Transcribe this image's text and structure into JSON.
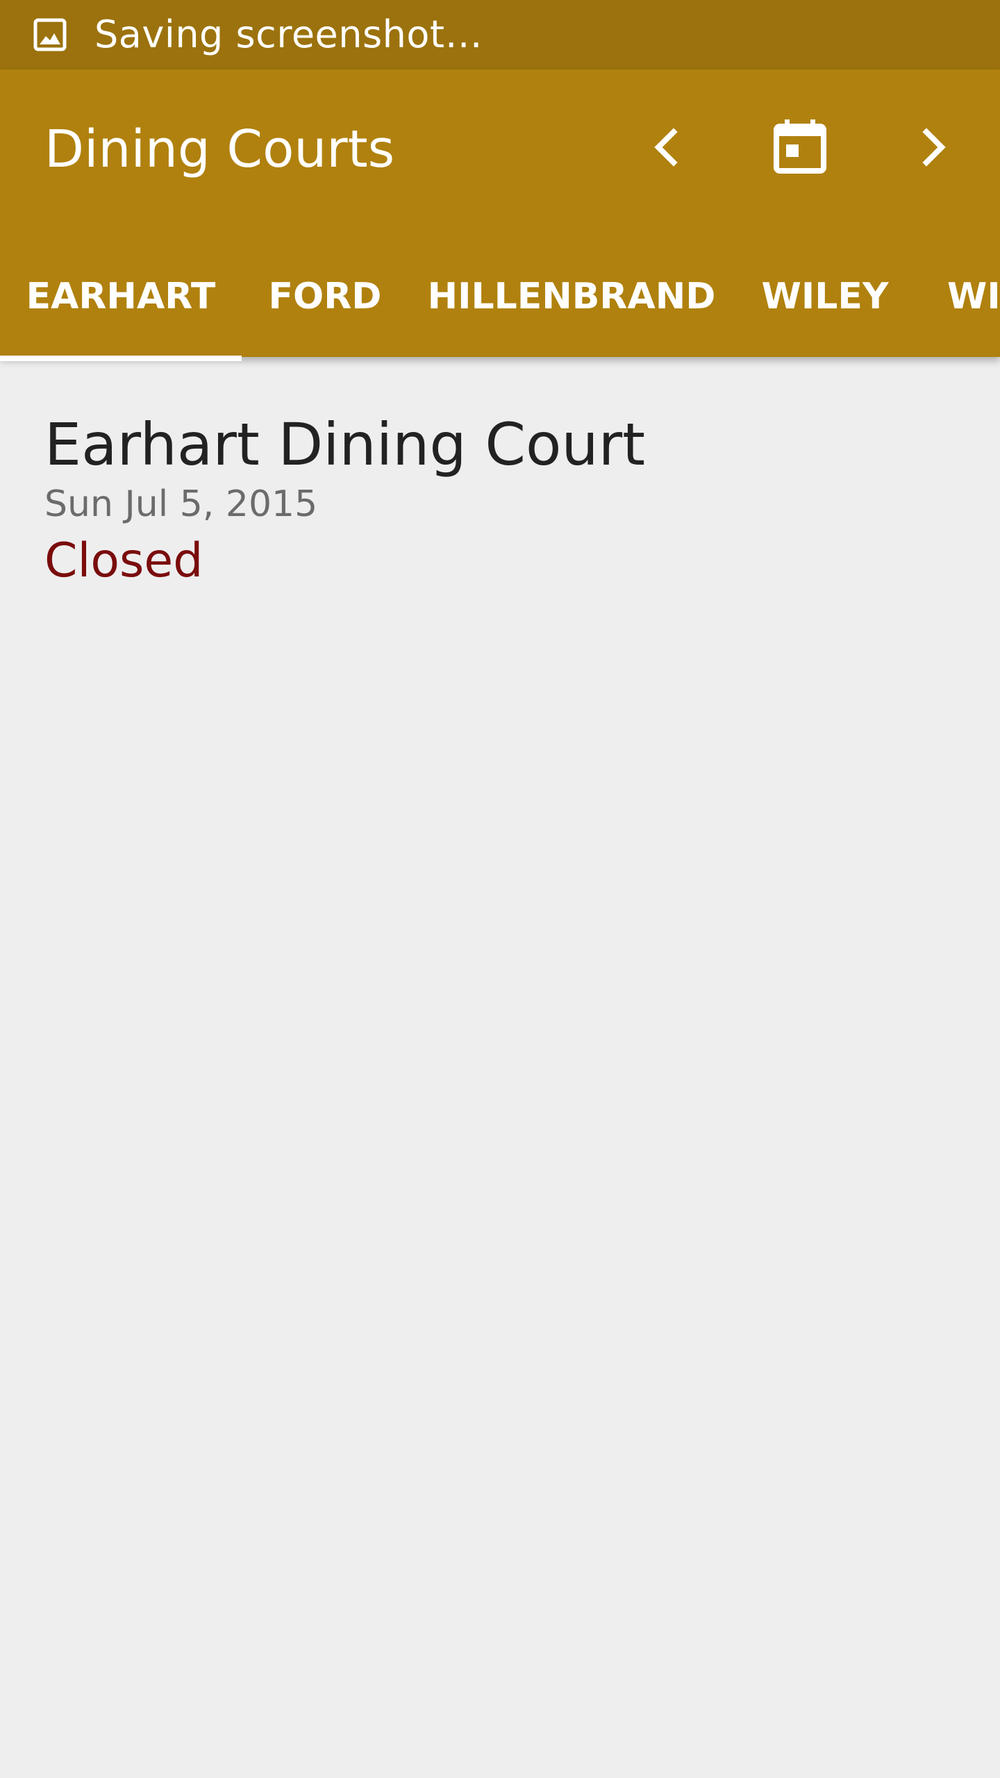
{
  "status_bar": {
    "notification_icon": "image-icon",
    "text": "Saving screenshot…"
  },
  "app_bar": {
    "title": "Dining Courts",
    "actions": {
      "prev_icon": "chevron-left-icon",
      "calendar_icon": "calendar-icon",
      "next_icon": "chevron-right-icon"
    },
    "color": "#b0810e"
  },
  "tabs": [
    {
      "label": "EARHART",
      "selected": true
    },
    {
      "label": "FORD",
      "selected": false
    },
    {
      "label": "HILLENBRAND",
      "selected": false
    },
    {
      "label": "WILEY",
      "selected": false
    },
    {
      "label": "WI",
      "selected": false
    }
  ],
  "content": {
    "name": "Earhart Dining Court",
    "date": "Sun Jul 5, 2015",
    "status": "Closed",
    "status_color": "#7a0c0c"
  }
}
